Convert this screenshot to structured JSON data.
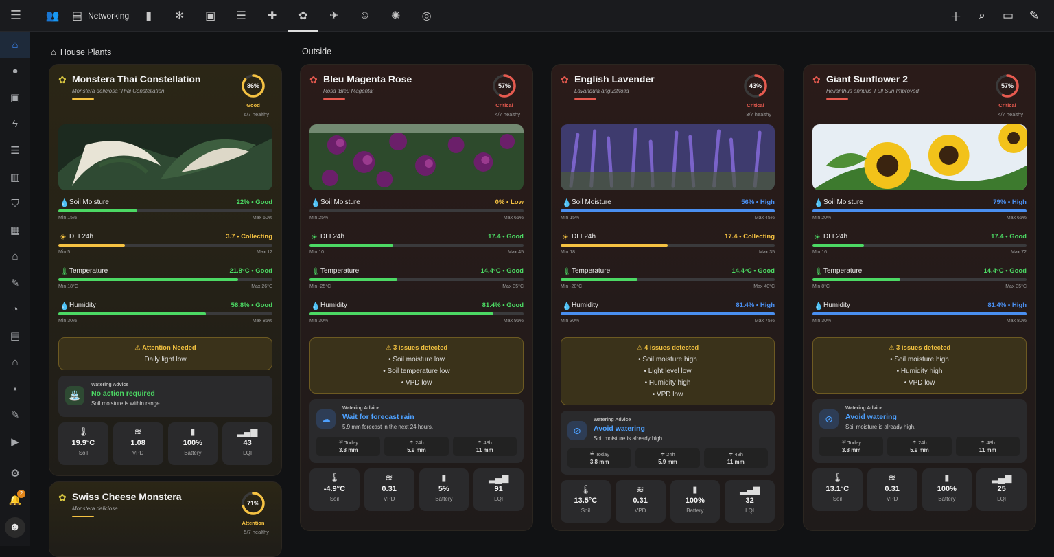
{
  "topbar": {
    "tabs": [
      {
        "icon": "group-icon",
        "glyph": "👥",
        "label": ""
      },
      {
        "icon": "server-icon",
        "glyph": "▤",
        "label": "Networking"
      },
      {
        "icon": "battery-icon",
        "glyph": "▮",
        "label": ""
      },
      {
        "icon": "ac-icon",
        "glyph": "✻",
        "label": ""
      },
      {
        "icon": "package-icon",
        "glyph": "▣",
        "label": ""
      },
      {
        "icon": "storage-icon",
        "glyph": "☰",
        "label": ""
      },
      {
        "icon": "medical-bag-icon",
        "glyph": "✚",
        "label": ""
      },
      {
        "icon": "flower-icon",
        "glyph": "✿",
        "label": ""
      },
      {
        "icon": "bird-icon",
        "glyph": "✈",
        "label": ""
      },
      {
        "icon": "cat-icon",
        "glyph": "☺",
        "label": ""
      },
      {
        "icon": "sparkle-icon",
        "glyph": "✺",
        "label": ""
      },
      {
        "icon": "vacuum-icon",
        "glyph": "◎",
        "label": ""
      }
    ],
    "active_tab": 7
  },
  "sidebar": {
    "items": [
      {
        "icon": "home-icon",
        "glyph": "⌂"
      },
      {
        "icon": "person-icon",
        "glyph": "●"
      },
      {
        "icon": "contact-icon",
        "glyph": "▣"
      },
      {
        "icon": "lightning-icon",
        "glyph": "ϟ"
      },
      {
        "icon": "list-icon",
        "glyph": "☰"
      },
      {
        "icon": "chart-icon",
        "glyph": "▥"
      },
      {
        "icon": "shield-icon",
        "glyph": "⛉"
      },
      {
        "icon": "calendar-icon",
        "glyph": "▦"
      },
      {
        "icon": "home-floor-icon",
        "glyph": "⌂"
      },
      {
        "icon": "wrench-icon",
        "glyph": "✎"
      },
      {
        "icon": "gauge-icon",
        "glyph": "◔"
      },
      {
        "icon": "hacs-icon",
        "glyph": "▤"
      },
      {
        "icon": "house-icon",
        "glyph": "⌂"
      },
      {
        "icon": "network-icon",
        "glyph": "⚹"
      },
      {
        "icon": "tools-icon",
        "glyph": "✎"
      },
      {
        "icon": "media-icon",
        "glyph": "▶"
      }
    ],
    "notification_count": "2"
  },
  "sections": {
    "house_plants": "House Plants",
    "outside": "Outside"
  },
  "colors": {
    "good": "#4cd964",
    "warn": "#f5c242",
    "high": "#4a8ff0",
    "low": "#f5c242",
    "critical": "#e65a4f",
    "attention": "#f5c242",
    "blue_title": "#4ea1ff",
    "green_title": "#4cd964"
  },
  "plants": [
    {
      "name": "Monstera Thai Constellation",
      "latin": "Monstera deliciosa 'Thai Constellation'",
      "icon_color": "#d8c640",
      "score": "86%",
      "score_num": 86,
      "status": "Good",
      "status_color": "#f5c242",
      "ring_color": "#f5c242",
      "healthy": "6/7 healthy",
      "metrics": [
        {
          "name": "Soil Moisture",
          "icon": "water-drop-icon",
          "glyph": "💧",
          "value": "22% • Good",
          "color": "#4cd964",
          "fill": 0.37,
          "min": "Min 15%",
          "max": "Max 60%"
        },
        {
          "name": "DLI 24h",
          "icon": "sun-icon",
          "glyph": "☀",
          "value": "3.7 • Collecting",
          "color": "#f5c242",
          "fill": 0.31,
          "min": "Min 5",
          "max": "Max 12"
        },
        {
          "name": "Temperature",
          "icon": "thermometer-icon",
          "glyph": "🌡",
          "value": "21.8°C • Good",
          "color": "#4cd964",
          "fill": 0.84,
          "min": "Min 18°C",
          "max": "Max 26°C"
        },
        {
          "name": "Humidity",
          "icon": "humidity-icon",
          "glyph": "💧",
          "value": "58.8% • Good",
          "color": "#4cd964",
          "fill": 0.69,
          "min": "Min 30%",
          "max": "Max 85%"
        }
      ],
      "alert": {
        "title": "⚠ Attention Needed",
        "lines": [
          "Daily light low"
        ]
      },
      "water": {
        "label": "Watering Advice",
        "title": "No action required",
        "title_color": "#4cd964",
        "desc": "Soil moisture is within range.",
        "icon": "watering-can-icon",
        "glyph": "⛲",
        "icon_bg": "#2e4a33",
        "forecast": []
      },
      "sensors": [
        {
          "v": "19.9°C",
          "l": "Soil",
          "icon": "soil-temp-icon",
          "glyph": "🌡"
        },
        {
          "v": "1.08",
          "l": "VPD",
          "icon": "wind-icon",
          "glyph": "≋"
        },
        {
          "v": "100%",
          "l": "Battery",
          "icon": "battery-icon",
          "glyph": "▮"
        },
        {
          "v": "43",
          "l": "LQI",
          "icon": "signal-icon",
          "glyph": "▂▄▆"
        }
      ]
    },
    {
      "name": "Bleu Magenta Rose",
      "latin": "Rosa 'Bleu Magenta'",
      "icon_color": "#e65a4f",
      "score": "57%",
      "score_num": 57,
      "status": "Critical",
      "status_color": "#e65a4f",
      "ring_color": "#e65a4f",
      "healthy": "4/7 healthy",
      "metrics": [
        {
          "name": "Soil Moisture",
          "icon": "water-drop-icon",
          "glyph": "💧",
          "value": "0% • Low",
          "color": "#f5c242",
          "fill": 0.0,
          "min": "Min 25%",
          "max": "Max 65%"
        },
        {
          "name": "DLI 24h",
          "icon": "sun-icon",
          "glyph": "☀",
          "value": "17.4 • Good",
          "color": "#4cd964",
          "fill": 0.39,
          "min": "Min 10",
          "max": "Max 45"
        },
        {
          "name": "Temperature",
          "icon": "thermometer-icon",
          "glyph": "🌡",
          "value": "14.4°C • Good",
          "color": "#4cd964",
          "fill": 0.41,
          "min": "Min -25°C",
          "max": "Max 35°C"
        },
        {
          "name": "Humidity",
          "icon": "humidity-icon",
          "glyph": "💧",
          "value": "81.4% • Good",
          "color": "#4cd964",
          "fill": 0.86,
          "min": "Min 30%",
          "max": "Max 95%"
        }
      ],
      "alert": {
        "title": "⚠ 3 issues detected",
        "lines": [
          "• Soil moisture low",
          "• Soil temperature low",
          "• VPD low"
        ]
      },
      "water": {
        "label": "Watering Advice",
        "title": "Wait for forecast rain",
        "title_color": "#4ea1ff",
        "desc": "5.9 mm forecast in the next 24 hours.",
        "icon": "rain-cloud-icon",
        "glyph": "☁",
        "icon_bg": "#2e3d55",
        "forecast": [
          {
            "l": "☔ Today",
            "v": "3.8 mm"
          },
          {
            "l": "☂ 24h",
            "v": "5.9 mm"
          },
          {
            "l": "☂ 48h",
            "v": "11 mm"
          }
        ]
      },
      "sensors": [
        {
          "v": "-4.9°C",
          "l": "Soil",
          "icon": "soil-temp-icon",
          "glyph": "🌡"
        },
        {
          "v": "0.31",
          "l": "VPD",
          "icon": "wind-icon",
          "glyph": "≋"
        },
        {
          "v": "5%",
          "l": "Battery",
          "icon": "battery-icon",
          "glyph": "▮"
        },
        {
          "v": "91",
          "l": "LQI",
          "icon": "signal-icon",
          "glyph": "▂▄▆"
        }
      ]
    },
    {
      "name": "English Lavender",
      "latin": "Lavandula angustifolia",
      "icon_color": "#e65a4f",
      "score": "43%",
      "score_num": 43,
      "status": "Critical",
      "status_color": "#e65a4f",
      "ring_color": "#e65a4f",
      "healthy": "3/7 healthy",
      "metrics": [
        {
          "name": "Soil Moisture",
          "icon": "water-drop-icon",
          "glyph": "💧",
          "value": "56% • High",
          "color": "#4a8ff0",
          "fill": 1.0,
          "min": "Min 15%",
          "max": "Max 45%"
        },
        {
          "name": "DLI 24h",
          "icon": "sun-icon",
          "glyph": "☀",
          "value": "17.4 • Collecting",
          "color": "#f5c242",
          "fill": 0.5,
          "min": "Min 18",
          "max": "Max 35"
        },
        {
          "name": "Temperature",
          "icon": "thermometer-icon",
          "glyph": "🌡",
          "value": "14.4°C • Good",
          "color": "#4cd964",
          "fill": 0.36,
          "min": "Min -20°C",
          "max": "Max 40°C"
        },
        {
          "name": "Humidity",
          "icon": "humidity-icon",
          "glyph": "💧",
          "value": "81.4% • High",
          "color": "#4a8ff0",
          "fill": 1.0,
          "min": "Min 30%",
          "max": "Max 75%"
        }
      ],
      "alert": {
        "title": "⚠ 4 issues detected",
        "lines": [
          "• Soil moisture high",
          "• Light level low",
          "• Humidity high",
          "• VPD low"
        ]
      },
      "water": {
        "label": "Watering Advice",
        "title": "Avoid watering",
        "title_color": "#4ea1ff",
        "desc": "Soil moisture is already high.",
        "icon": "no-water-icon",
        "glyph": "⊘",
        "icon_bg": "#2e3d55",
        "forecast": [
          {
            "l": "☔ Today",
            "v": "3.8 mm"
          },
          {
            "l": "☂ 24h",
            "v": "5.9 mm"
          },
          {
            "l": "☂ 48h",
            "v": "11 mm"
          }
        ]
      },
      "sensors": [
        {
          "v": "13.5°C",
          "l": "Soil",
          "icon": "soil-temp-icon",
          "glyph": "🌡"
        },
        {
          "v": "0.31",
          "l": "VPD",
          "icon": "wind-icon",
          "glyph": "≋"
        },
        {
          "v": "100%",
          "l": "Battery",
          "icon": "battery-icon",
          "glyph": "▮"
        },
        {
          "v": "32",
          "l": "LQI",
          "icon": "signal-icon",
          "glyph": "▂▄▆"
        }
      ]
    },
    {
      "name": "Giant Sunflower 2",
      "latin": "Helianthus annuus 'Full Sun Improved'",
      "icon_color": "#e65a4f",
      "score": "57%",
      "score_num": 57,
      "status": "Critical",
      "status_color": "#e65a4f",
      "ring_color": "#e65a4f",
      "healthy": "4/7 healthy",
      "metrics": [
        {
          "name": "Soil Moisture",
          "icon": "water-drop-icon",
          "glyph": "💧",
          "value": "79% • High",
          "color": "#4a8ff0",
          "fill": 1.0,
          "min": "Min 20%",
          "max": "Max 65%"
        },
        {
          "name": "DLI 24h",
          "icon": "sun-icon",
          "glyph": "☀",
          "value": "17.4 • Good",
          "color": "#4cd964",
          "fill": 0.24,
          "min": "Min 16",
          "max": "Max 72"
        },
        {
          "name": "Temperature",
          "icon": "thermometer-icon",
          "glyph": "🌡",
          "value": "14.4°C • Good",
          "color": "#4cd964",
          "fill": 0.41,
          "min": "Min 8°C",
          "max": "Max 35°C"
        },
        {
          "name": "Humidity",
          "icon": "humidity-icon",
          "glyph": "💧",
          "value": "81.4% • High",
          "color": "#4a8ff0",
          "fill": 1.0,
          "min": "Min 30%",
          "max": "Max 80%"
        }
      ],
      "alert": {
        "title": "⚠ 3 issues detected",
        "lines": [
          "• Soil moisture high",
          "• Humidity high",
          "• VPD low"
        ]
      },
      "water": {
        "label": "Watering Advice",
        "title": "Avoid watering",
        "title_color": "#4ea1ff",
        "desc": "Soil moisture is already high.",
        "icon": "no-water-icon",
        "glyph": "⊘",
        "icon_bg": "#2e3d55",
        "forecast": [
          {
            "l": "☔ Today",
            "v": "3.8 mm"
          },
          {
            "l": "☂ 24h",
            "v": "5.9 mm"
          },
          {
            "l": "☂ 48h",
            "v": "11 mm"
          }
        ]
      },
      "sensors": [
        {
          "v": "13.1°C",
          "l": "Soil",
          "icon": "soil-temp-icon",
          "glyph": "🌡"
        },
        {
          "v": "0.31",
          "l": "VPD",
          "icon": "wind-icon",
          "glyph": "≋"
        },
        {
          "v": "100%",
          "l": "Battery",
          "icon": "battery-icon",
          "glyph": "▮"
        },
        {
          "v": "25",
          "l": "LQI",
          "icon": "signal-icon",
          "glyph": "▂▄▆"
        }
      ]
    }
  ],
  "second_plant": {
    "name": "Swiss Cheese Monstera",
    "latin": "Monstera deliciosa",
    "score": "71%",
    "score_num": 71,
    "status": "Attention",
    "status_color": "#f5c242",
    "ring_color": "#f5c242",
    "healthy": "5/7 healthy",
    "icon_color": "#d8c640"
  }
}
